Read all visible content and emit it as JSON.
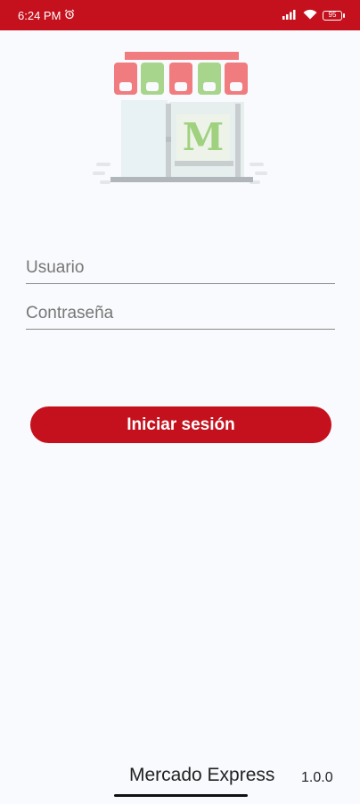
{
  "status_bar": {
    "time": "6:24 PM",
    "battery": "95",
    "background": "#c4111d"
  },
  "logo": {
    "letter": "M",
    "awning_colors": [
      "#f07c80",
      "#a8d58c"
    ]
  },
  "form": {
    "username_placeholder": "Usuario",
    "password_placeholder": "Contraseña",
    "login_label": "Iniciar sesión"
  },
  "footer": {
    "app_name": "Mercado Express",
    "version": "1.0.0"
  }
}
